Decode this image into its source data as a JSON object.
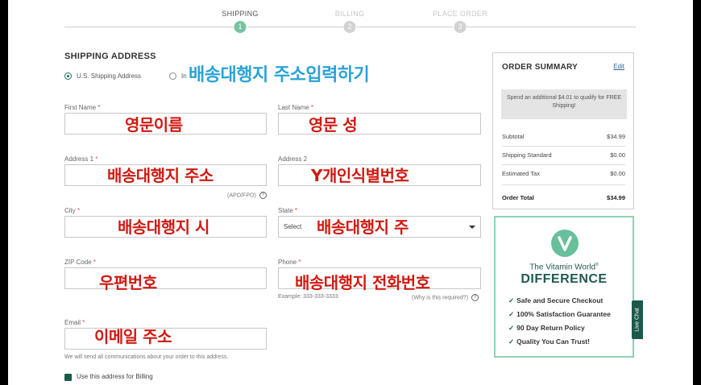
{
  "steps": [
    {
      "label": "SHIPPING",
      "num": "1"
    },
    {
      "label": "BILLING",
      "num": "2"
    },
    {
      "label": "PLACE ORDER",
      "num": "3"
    }
  ],
  "shipping": {
    "title": "SHIPPING ADDRESS",
    "radio_us": "U.S. Shipping Address",
    "radio_intl": "In"
  },
  "form": {
    "first_name_label": "First Name",
    "last_name_label": "Last Name",
    "address1_label": "Address 1",
    "address2_label": "Address 2",
    "apo_hint": "(APO/FPO)",
    "city_label": "City",
    "state_label": "State",
    "state_value": "Select",
    "zip_label": "ZIP Code",
    "phone_label": "Phone",
    "phone_example": "Example: 333-333-3333",
    "phone_why": "(Why is this required?)",
    "email_label": "Email",
    "email_hint": "We will send all communications about your order to this address.",
    "billing_checkbox": "Use this address for Billing",
    "req": "*",
    "q": "?"
  },
  "overlays": {
    "heading": "배송대행지 주소입력하기",
    "first_name": "영문이름",
    "last_name": "영문 성",
    "address1": "배송대행지 주소",
    "address2": "Y개인식별번호",
    "city": "배송대행지 시",
    "state": "배송대행지 주",
    "zip": "우편번호",
    "phone": "배송대행지 전화번호",
    "email": "이메일 주소"
  },
  "summary": {
    "title": "ORDER SUMMARY",
    "edit": "Edit",
    "promo": "Spend an additional $4.01 to qualify for FREE Shipping!",
    "rows": [
      {
        "label": "Subtotal",
        "value": "$34.99"
      },
      {
        "label": "Shipping Standard",
        "value": "$0.00"
      },
      {
        "label": "Estimated Tax",
        "value": "$0.00"
      },
      {
        "label": "Order Total",
        "value": "$34.99"
      }
    ]
  },
  "vw": {
    "title1": "The Vitamin World",
    "reg": "®",
    "title2": "DIFFERENCE",
    "check": "✓",
    "items": [
      "Safe and Secure Checkout",
      "100% Satisfaction Guarantee",
      "90 Day Return Policy",
      "Quality You Can Trust!"
    ]
  },
  "livechat": "Live Chat",
  "colors": {
    "accent": "#1b5a4a",
    "step_active": "#76c3a2",
    "overlay_red": "#d01a12",
    "overlay_blue": "#2aa3d8"
  }
}
